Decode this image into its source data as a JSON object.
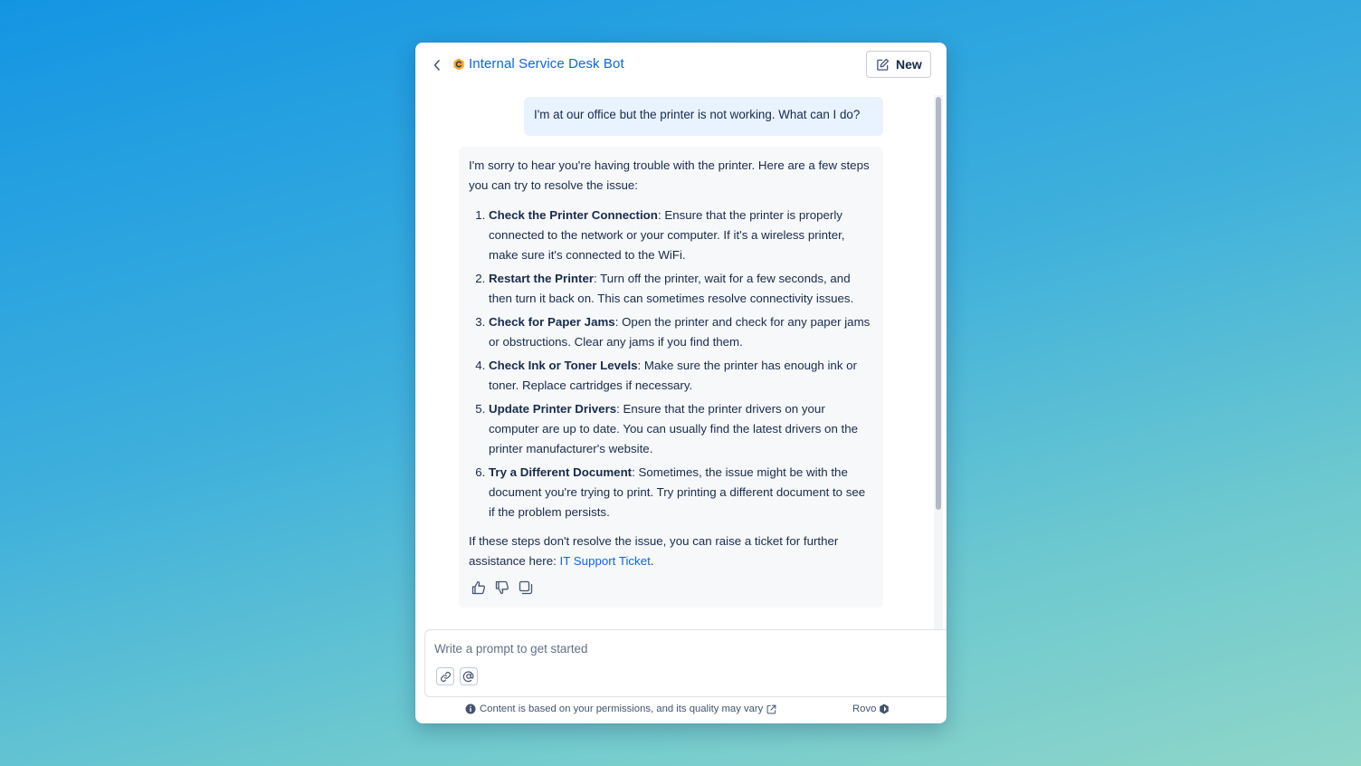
{
  "header": {
    "back_icon": "chevron-left-icon",
    "bot_name": "Internal Service Desk Bot",
    "bot_icon_color": "#f5a623",
    "new_label": "New",
    "new_icon": "edit-icon"
  },
  "conversation": {
    "user_message": "I'm at our office but the printer is not working. What can I do?",
    "bot_intro": "I'm sorry to hear you're having trouble with the printer. Here are a few steps you can try to resolve the issue:",
    "steps": [
      {
        "title": "Check the Printer Connection",
        "text": ": Ensure that the printer is properly connected to the network or your computer. If it's a wireless printer, make sure it's connected to the WiFi."
      },
      {
        "title": "Restart the Printer",
        "text": ": Turn off the printer, wait for a few seconds, and then turn it back on. This can sometimes resolve connectivity issues."
      },
      {
        "title": "Check for Paper Jams",
        "text": ": Open the printer and check for any paper jams or obstructions. Clear any jams if you find them."
      },
      {
        "title": "Check Ink or Toner Levels",
        "text": ": Make sure the printer has enough ink or toner. Replace cartridges if necessary."
      },
      {
        "title": "Update Printer Drivers",
        "text": ": Ensure that the printer drivers on your computer are up to date. You can usually find the latest drivers on the printer manufacturer's website."
      },
      {
        "title": "Try a Different Document",
        "text": ": Sometimes, the issue might be with the document you're trying to print. Try printing a different document to see if the problem persists."
      }
    ],
    "closing_prefix": "If these steps don't resolve the issue, you can raise a ticket for further assistance here: ",
    "closing_link": "IT Support Ticket",
    "closing_suffix": ".",
    "actions": [
      "thumbs-up-icon",
      "thumbs-down-icon",
      "copy-icon"
    ]
  },
  "composer": {
    "placeholder": "Write a prompt to get started",
    "tools": [
      "link-icon",
      "mention-icon"
    ]
  },
  "footer": {
    "disclaimer": "Content is based on your permissions, and its quality may vary",
    "brand": "Rovo"
  },
  "colors": {
    "accent": "#0c66e4",
    "user_bubble": "#e9f2ff",
    "bot_bubble": "#f7f8f9"
  }
}
